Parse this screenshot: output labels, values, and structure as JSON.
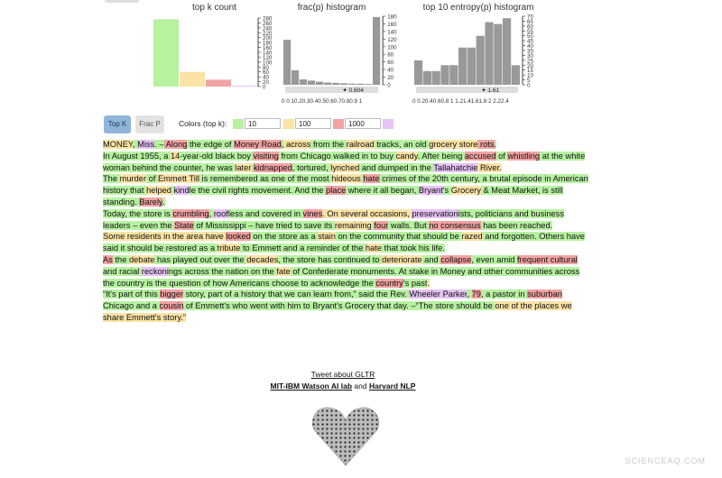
{
  "charts": {
    "topk": {
      "title": "top k count",
      "bars": [
        {
          "value": 275,
          "color": "#b6f2a0"
        },
        {
          "value": 60,
          "color": "#fbe3a5"
        },
        {
          "value": 28,
          "color": "#f2a2a2"
        },
        {
          "value": 4,
          "color": "#e6c3f4"
        }
      ],
      "yticks": [
        "280",
        "260",
        "240",
        "220",
        "200",
        "180",
        "160",
        "140",
        "120",
        "100",
        "80",
        "60",
        "40",
        "20",
        "0"
      ],
      "ymax": 280
    },
    "frac": {
      "title": "frac(p) histogram",
      "values": [
        118,
        38,
        14,
        11,
        8,
        6,
        5,
        4,
        3,
        3,
        2,
        178
      ],
      "ymax": 180,
      "yticks": [
        "180",
        "160",
        "140",
        "120",
        "100",
        "80",
        "60",
        "40",
        "20",
        "0"
      ],
      "xticks": "0 0.10.20.30.40.50.60.70.80.9  1",
      "slider_label": "0.604"
    },
    "entropy": {
      "title": "top 10 entropy(p) histogram",
      "values": [
        25,
        14,
        14,
        20,
        20,
        38,
        38,
        50,
        64,
        62,
        68,
        20
      ],
      "ymax": 70,
      "yticks": [
        "70",
        "65",
        "60",
        "55",
        "50",
        "45",
        "40",
        "35",
        "30",
        "25",
        "20",
        "15",
        "10",
        "5",
        "0"
      ],
      "xticks": "0 0.20.40.60.8 1 1.21.41.61.8 2 2.22.4",
      "slider_label": "1.61"
    }
  },
  "controls": {
    "topk_button": "Top K",
    "fracp_button": "Frac P",
    "colors_label": "Colors (top k):",
    "inputs": [
      "10",
      "100",
      "1000"
    ],
    "swatches": [
      "#b6f2a0",
      "#fbe3a5",
      "#f2a2a2",
      "#e6c3f4"
    ]
  },
  "paragraphs": [
    [
      [
        "MONEY",
        "y"
      ],
      [
        ", ",
        "g"
      ],
      [
        "Miss",
        "p"
      ],
      [
        ". –",
        "g"
      ],
      [
        " Along",
        "r"
      ],
      [
        " the edge of ",
        "g"
      ],
      [
        "Money Road",
        "r"
      ],
      [
        ",",
        "g"
      ],
      [
        " across",
        "y"
      ],
      [
        " from the ",
        "g"
      ],
      [
        "railroad",
        "y"
      ],
      [
        " tracks, an old ",
        "g"
      ],
      [
        "grocery store",
        "y"
      ],
      [
        " rots",
        "r"
      ],
      [
        ".",
        "g"
      ]
    ],
    [
      [
        "In August 1955, a ",
        "g"
      ],
      [
        "14",
        "y"
      ],
      [
        "-year-old black boy ",
        "g"
      ],
      [
        "visiting",
        "r"
      ],
      [
        " from Chicago walked in to buy ",
        "g"
      ],
      [
        "candy",
        "y"
      ],
      [
        ". After being ",
        "g"
      ],
      [
        "accused",
        "r"
      ],
      [
        " of ",
        "g"
      ],
      [
        "whistling",
        "r"
      ],
      [
        " at the white woman behind the counter, he was ",
        "g"
      ],
      [
        "later",
        "y"
      ],
      [
        " ",
        "g"
      ],
      [
        "kidnapped",
        "r"
      ],
      [
        ", tortured, ",
        "g"
      ],
      [
        "lynched",
        "y"
      ],
      [
        " and dumped in the ",
        "g"
      ],
      [
        "Tallahatchie",
        "p"
      ],
      [
        " River.",
        "y"
      ]
    ],
    [
      [
        "The ",
        "g"
      ],
      [
        "murder",
        "y"
      ],
      [
        " of ",
        "g"
      ],
      [
        "Emmett Till",
        "y"
      ],
      [
        " is remembered as one of the most ",
        "g"
      ],
      [
        "hideous",
        "y"
      ],
      [
        " ",
        "g"
      ],
      [
        "hate",
        "r"
      ],
      [
        " crimes of the 20th century, a brutal episode in American history that ",
        "g"
      ],
      [
        "helped",
        "y"
      ],
      [
        " ",
        "g"
      ],
      [
        "kind",
        "p"
      ],
      [
        "le the civil rights movement. And the ",
        "g"
      ],
      [
        "place",
        "r"
      ],
      [
        " where it all began, ",
        "g"
      ],
      [
        "Bryant",
        "p"
      ],
      [
        "'s ",
        "g"
      ],
      [
        "Grocery",
        "y"
      ],
      [
        " & Meat Market, is still standing. ",
        "g"
      ],
      [
        "Barely",
        "r"
      ],
      [
        ".",
        "g"
      ]
    ],
    [
      [
        "Today, the store is ",
        "g"
      ],
      [
        "crumbling",
        "r"
      ],
      [
        ", ",
        "g"
      ],
      [
        "roof",
        "p"
      ],
      [
        "less and covered in ",
        "g"
      ],
      [
        "vines",
        "r"
      ],
      [
        ". On several occasions, ",
        "y"
      ],
      [
        "preservation",
        "p"
      ],
      [
        "ists, politicians and business leaders – even the ",
        "g"
      ],
      [
        "State",
        "r"
      ],
      [
        " of Mississippi – have tried to save its ",
        "g"
      ],
      [
        "remaining",
        "y"
      ],
      [
        " ",
        "g"
      ],
      [
        "four",
        "r"
      ],
      [
        " walls. But ",
        "g"
      ],
      [
        "no consensus",
        "r"
      ],
      [
        " has been reached.",
        "g"
      ]
    ],
    [
      [
        "Some residents in the area have ",
        "y"
      ],
      [
        "looked",
        "r"
      ],
      [
        " on the store as a ",
        "g"
      ],
      [
        "stain",
        "y"
      ],
      [
        " on the community that should be ",
        "g"
      ],
      [
        "razed",
        "y"
      ],
      [
        " and forgotten. Others have said it should be restored as a ",
        "g"
      ],
      [
        "tribute",
        "y"
      ],
      [
        " to Emmett and a reminder of the ",
        "g"
      ],
      [
        "hate",
        "y"
      ],
      [
        " that took his life.",
        "g"
      ]
    ],
    [
      [
        "As",
        "r"
      ],
      [
        " the ",
        "g"
      ],
      [
        "debate",
        "y"
      ],
      [
        " has played out over the ",
        "g"
      ],
      [
        "decades",
        "y"
      ],
      [
        ", the store has continued to ",
        "g"
      ],
      [
        "deteriorate",
        "y"
      ],
      [
        " and ",
        "g"
      ],
      [
        "collapse",
        "r"
      ],
      [
        ", even amid ",
        "g"
      ],
      [
        "frequent cultural",
        "r"
      ],
      [
        " and racial ",
        "g"
      ],
      [
        "reckon",
        "p"
      ],
      [
        "ings across the nation on the ",
        "g"
      ],
      [
        "fate",
        "y"
      ],
      [
        " of Confederate monuments. At stake in Money and other communities across the country is the question of how Americans choose to acknowledge the ",
        "g"
      ],
      [
        "country",
        "r"
      ],
      [
        "'s past",
        "g"
      ],
      [
        ".",
        "y"
      ]
    ],
    [
      [
        "“It's part of this ",
        "g"
      ],
      [
        "bigger",
        "r"
      ],
      [
        " story, part of a history that we can learn from,” said the Rev. ",
        "g"
      ],
      [
        "Wheeler Parker",
        "p"
      ],
      [
        ", ",
        "g"
      ],
      [
        "79",
        "r"
      ],
      [
        ", a pastor in ",
        "g"
      ],
      [
        "suburban",
        "r"
      ],
      [
        " Chicago and a ",
        "g"
      ],
      [
        "cousin",
        "r"
      ],
      [
        " of Emmett's who went with him to Bryant's Grocery that day. –“The store should be ",
        "g"
      ],
      [
        "one of the places we share Emmett's story.”",
        "y"
      ]
    ]
  ],
  "footer": {
    "tweet": "Tweet about GLTR",
    "mit": "MIT-IBM Watson AI lab",
    "and": " and ",
    "harvard": "Harvard NLP"
  },
  "watermark": "SCIENCEAQ.COM"
}
